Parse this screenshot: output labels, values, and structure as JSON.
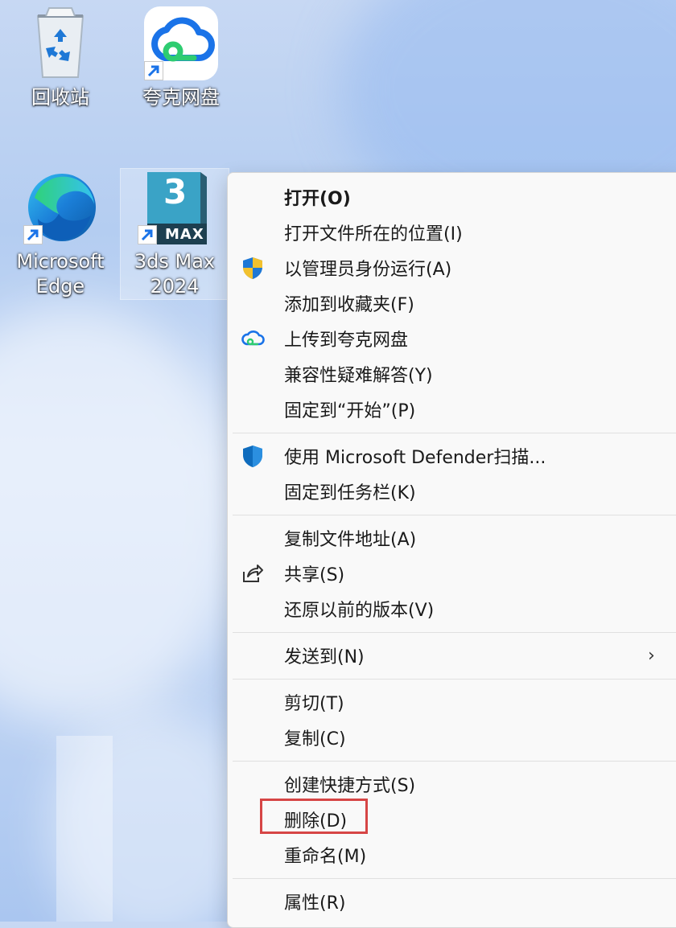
{
  "desktop": {
    "icons": [
      {
        "label": "回收站",
        "icon": "recycle-bin-icon"
      },
      {
        "label": "夸克网盘",
        "icon": "quark-cloud-icon"
      },
      {
        "label": "Microsoft Edge",
        "icon": "edge-icon"
      },
      {
        "label": "3ds Max 2024",
        "icon": "3ds-max-icon"
      }
    ]
  },
  "menu": {
    "items": [
      {
        "label": "打开(O)",
        "icon": ""
      },
      {
        "label": "打开文件所在的位置(I)",
        "icon": ""
      },
      {
        "label": "以管理员身份运行(A)",
        "icon": "uac-shield-icon"
      },
      {
        "label": "添加到收藏夹(F)",
        "icon": ""
      },
      {
        "label": "上传到夸克网盘",
        "icon": "quark-cloud-icon"
      },
      {
        "label": "兼容性疑难解答(Y)",
        "icon": ""
      },
      {
        "label": "固定到“开始”(P)",
        "icon": ""
      },
      {
        "label": "使用 Microsoft Defender扫描...",
        "icon": "defender-shield-icon"
      },
      {
        "label": "固定到任务栏(K)",
        "icon": ""
      },
      {
        "label": "复制文件地址(A)",
        "icon": ""
      },
      {
        "label": "共享(S)",
        "icon": "share-icon"
      },
      {
        "label": "还原以前的版本(V)",
        "icon": ""
      },
      {
        "label": "发送到(N)",
        "icon": "",
        "submenu": true
      },
      {
        "label": "剪切(T)",
        "icon": ""
      },
      {
        "label": "复制(C)",
        "icon": ""
      },
      {
        "label": "创建快捷方式(S)",
        "icon": ""
      },
      {
        "label": "删除(D)",
        "icon": "",
        "highlighted": true
      },
      {
        "label": "重命名(M)",
        "icon": ""
      },
      {
        "label": "属性(R)",
        "icon": ""
      }
    ],
    "submenu_arrow": "›",
    "highlight_color": "#d64545"
  },
  "icon_text": {
    "max_digit": "3",
    "max_word": "MAX"
  }
}
